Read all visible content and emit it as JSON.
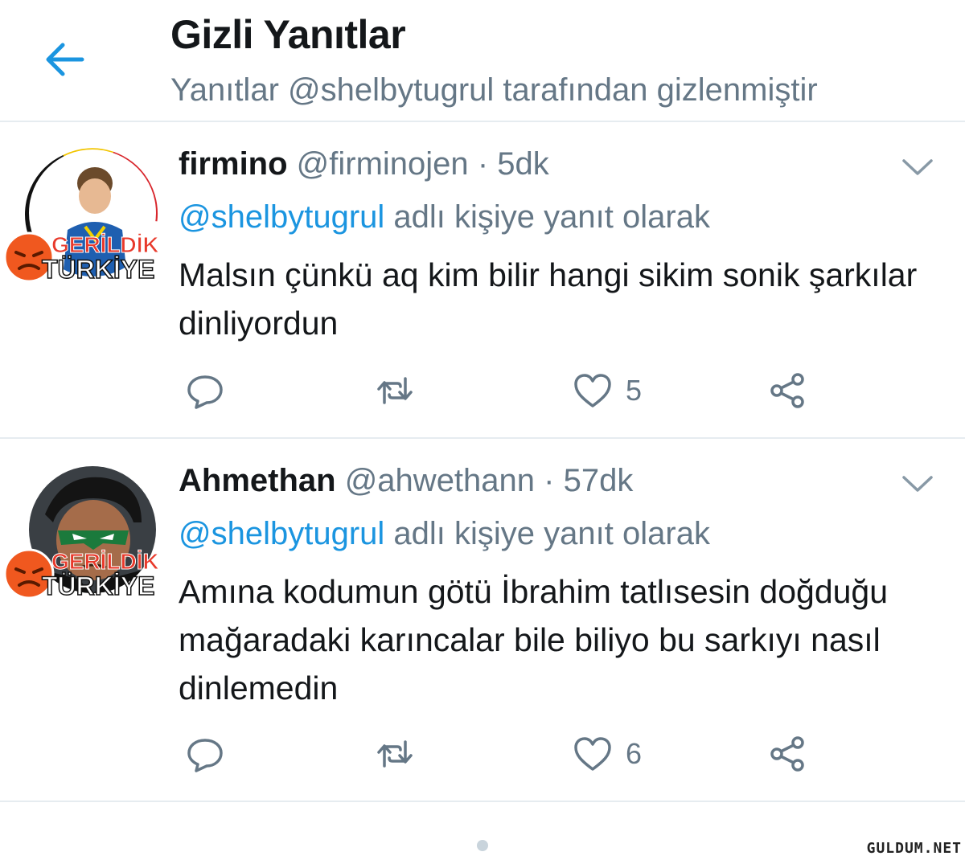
{
  "header": {
    "title": "Gizli Yanıtlar",
    "subtitle": "Yanıtlar @shelbytugrul tarafından gizlenmiştir",
    "back_icon": "arrow-left-icon"
  },
  "colors": {
    "accent": "#1b95e0",
    "text_primary": "#14171a",
    "text_secondary": "#657786",
    "divider": "#e6ecf0"
  },
  "overlay_logo": {
    "line1": "GERİLDİK",
    "line2": "TÜRKİYE"
  },
  "tweets": [
    {
      "name": "firmino",
      "handle": "@firminojen",
      "separator": "·",
      "time": "5dk",
      "reply_prefix": "@shelbytugrul",
      "reply_suffix": "adlı kişiye yanıt olarak",
      "text": "Malsın çünkü aq kim bilir hangi sikim sonik şarkılar dinliyordun",
      "likes": "5"
    },
    {
      "name": "Ahmethan",
      "handle": "@ahwethann",
      "separator": "·",
      "time": "57dk",
      "reply_prefix": "@shelbytugrul",
      "reply_suffix": "adlı kişiye yanıt olarak",
      "text": "Amına kodumun götü İbrahim tatlısesin doğduğu mağaradaki karıncalar bile biliyo bu sarkıyı nasıl dinlemedin",
      "likes": "6"
    }
  ],
  "watermark": "GULDUM.NET"
}
